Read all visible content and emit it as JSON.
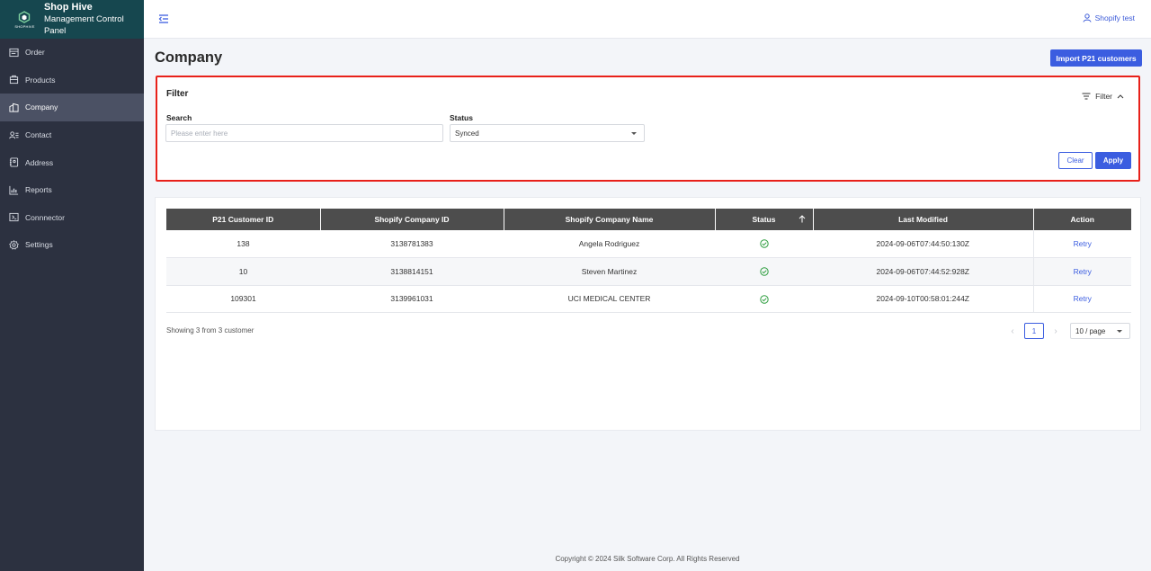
{
  "brand": {
    "title": "Shop Hive",
    "subtitle": "Management Control Panel",
    "logo_text": "SHOPHIVE"
  },
  "sidebar": {
    "items": [
      {
        "label": "Order",
        "icon": "order-icon",
        "active": false
      },
      {
        "label": "Products",
        "icon": "products-icon",
        "active": false
      },
      {
        "label": "Company",
        "icon": "company-icon",
        "active": true
      },
      {
        "label": "Contact",
        "icon": "contact-icon",
        "active": false
      },
      {
        "label": "Address",
        "icon": "address-icon",
        "active": false
      },
      {
        "label": "Reports",
        "icon": "reports-icon",
        "active": false
      },
      {
        "label": "Connnector",
        "icon": "connector-icon",
        "active": false
      },
      {
        "label": "Settings",
        "icon": "settings-icon",
        "active": false
      }
    ]
  },
  "header": {
    "user_name": "Shopify test"
  },
  "page": {
    "title": "Company",
    "import_button": "Import P21 customers"
  },
  "filter": {
    "title": "Filter",
    "toggle_label": "Filter",
    "search_label": "Search",
    "search_placeholder": "Please enter here",
    "search_value": "",
    "status_label": "Status",
    "status_value": "Synced",
    "clear_label": "Clear",
    "apply_label": "Apply"
  },
  "table": {
    "columns": [
      "P21 Customer ID",
      "Shopify Company ID",
      "Shopify Company Name",
      "Status",
      "Last Modified",
      "Action"
    ],
    "rows": [
      {
        "p21_id": "138",
        "shopify_id": "3138781383",
        "name": "Angela Rodriguez",
        "status": "synced",
        "last_modified": "2024-09-06T07:44:50:130Z",
        "action": "Retry"
      },
      {
        "p21_id": "10",
        "shopify_id": "3138814151",
        "name": "Steven Martinez",
        "status": "synced",
        "last_modified": "2024-09-06T07:44:52:928Z",
        "action": "Retry"
      },
      {
        "p21_id": "109301",
        "shopify_id": "3139961031",
        "name": "UCI MEDICAL CENTER",
        "status": "synced",
        "last_modified": "2024-09-10T00:58:01:244Z",
        "action": "Retry"
      }
    ],
    "showing_text": "Showing 3 from 3 customer",
    "current_page": "1",
    "page_size": "10 / page"
  },
  "footer": {
    "copyright": "Copyright © 2024 Silk Software Corp. All Rights Reserved"
  },
  "colors": {
    "accent": "#3b5de0",
    "sidebar": "#2c3140",
    "brand_bg": "#16474f",
    "success": "#2e9e3f",
    "highlight_border": "#e8211a"
  }
}
